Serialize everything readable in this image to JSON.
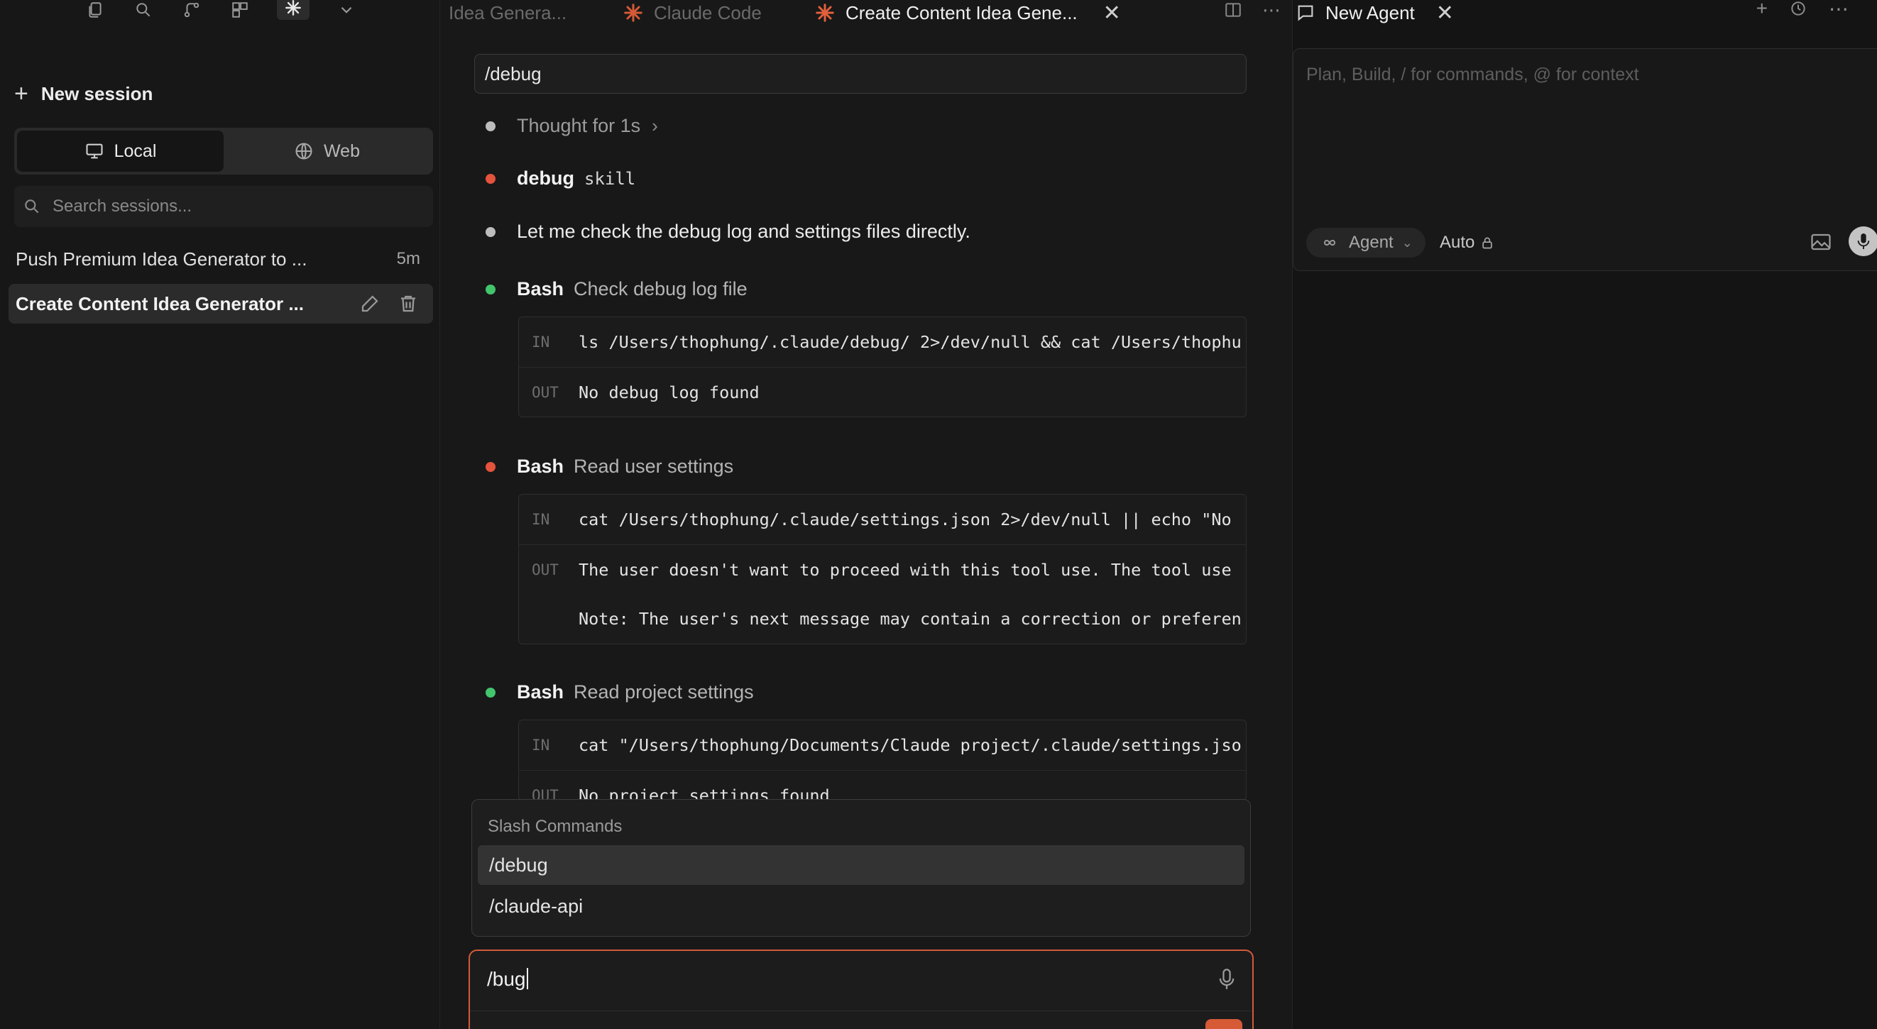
{
  "sidebar": {
    "toolbar_icons": [
      "files-icon",
      "search-icon",
      "branch-icon",
      "extensions-icon",
      "claude-spark-icon",
      "chevron-down-icon"
    ],
    "new_session_label": "New session",
    "segment": {
      "local": "Local",
      "web": "Web"
    },
    "search_placeholder": "Search sessions...",
    "sessions": [
      {
        "title": "Push Premium Idea Generator to ...",
        "time": "5m"
      },
      {
        "title": "Create Content Idea Generator ..."
      }
    ]
  },
  "center": {
    "tabs": [
      {
        "label": "Idea Genera..."
      },
      {
        "label": "Claude Code"
      },
      {
        "label": "Create Content Idea Gene..."
      }
    ],
    "command_echo": "/debug",
    "thought": "Thought for 1s",
    "skill": {
      "name": "debug",
      "kind": "skill"
    },
    "message": "Let me check the debug log and settings files directly.",
    "tools": [
      {
        "tool": "Bash",
        "desc": "Check debug log file",
        "status": "success",
        "in": "ls /Users/thophung/.claude/debug/ 2>/dev/null && cat /Users/thophu",
        "out": [
          "No debug log found"
        ]
      },
      {
        "tool": "Bash",
        "desc": "Read user settings",
        "status": "error",
        "in": "cat /Users/thophung/.claude/settings.json 2>/dev/null || echo \"No",
        "out": [
          "The user doesn't want to proceed with this tool use. The tool use",
          "Note: The user's next message may contain a correction or preferen"
        ]
      },
      {
        "tool": "Bash",
        "desc": "Read project settings",
        "status": "success",
        "in": "cat \"/Users/thophung/Documents/Claude project/.claude/settings.jso",
        "out": [
          "No project settings found"
        ]
      }
    ],
    "io_labels": {
      "in": "IN",
      "out": "OUT"
    },
    "slash": {
      "title": "Slash Commands",
      "items": [
        "/debug",
        "/claude-api"
      ],
      "selected": "/debug"
    },
    "input_value": "/bug",
    "accent": "#d65a36"
  },
  "right": {
    "tab_label": "New Agent",
    "placeholder": "Plan, Build, / for commands, @ for context",
    "mode_label": "Agent",
    "auto_label": "Auto"
  },
  "colors": {
    "status_success": "#42c56c",
    "status_error": "#e5533d",
    "status_neutral": "#bdbdbd"
  }
}
